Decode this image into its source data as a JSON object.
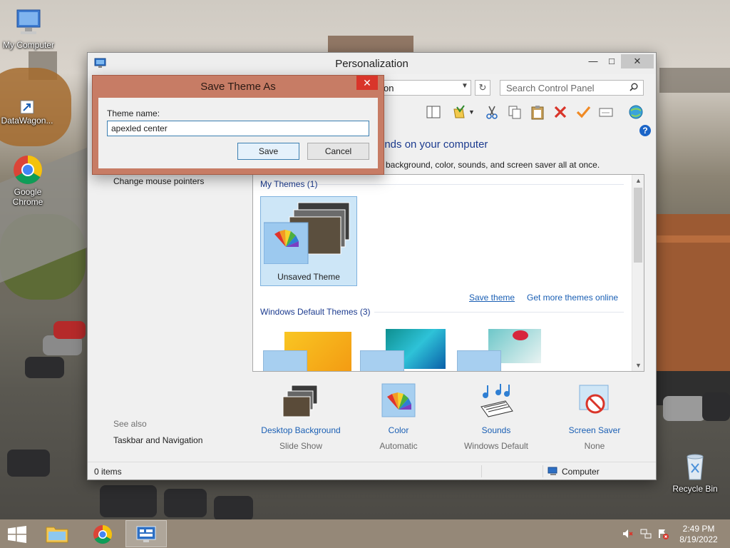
{
  "desktop": {
    "icons": [
      {
        "label": "My Computer"
      },
      {
        "label": "DataWagon..."
      },
      {
        "label": "Google Chrome"
      },
      {
        "label": "Recycle Bin"
      }
    ]
  },
  "window": {
    "title": "Personalization",
    "address_text": "on",
    "search_placeholder": "Search Control Panel",
    "heading": "unds on your computer",
    "subheading": "p background, color, sounds, and screen saver all at once.",
    "left_links": [
      "Change mouse pointers"
    ],
    "see_also": {
      "title": "See also",
      "links": [
        "Taskbar and Navigation"
      ]
    },
    "themes": {
      "my_themes_title": "My Themes (1)",
      "my_themes": [
        {
          "label": "Unsaved Theme",
          "selected": true
        }
      ],
      "save_theme_link": "Save theme",
      "get_more_link": "Get more themes online",
      "default_themes_title": "Windows Default Themes (3)"
    },
    "options": [
      {
        "title": "Desktop Background",
        "subtitle": "Slide Show",
        "icon": "desktop-background-icon"
      },
      {
        "title": "Color",
        "subtitle": "Automatic",
        "icon": "color-icon"
      },
      {
        "title": "Sounds",
        "subtitle": "Windows Default",
        "icon": "sounds-icon"
      },
      {
        "title": "Screen Saver",
        "subtitle": "None",
        "icon": "screen-saver-icon"
      }
    ],
    "status": {
      "items": "0 items",
      "location": "Computer"
    }
  },
  "dialog": {
    "title": "Save Theme As",
    "label": "Theme name:",
    "value": "apexled center",
    "save_label": "Save",
    "cancel_label": "Cancel"
  },
  "taskbar": {
    "time": "2:49 PM",
    "date": "8/19/2022"
  },
  "colors": {
    "dialog_frame": "#c77c65",
    "close_red": "#d9352a",
    "link_blue": "#1a5fb4",
    "heading_blue": "#1c3b8f"
  }
}
